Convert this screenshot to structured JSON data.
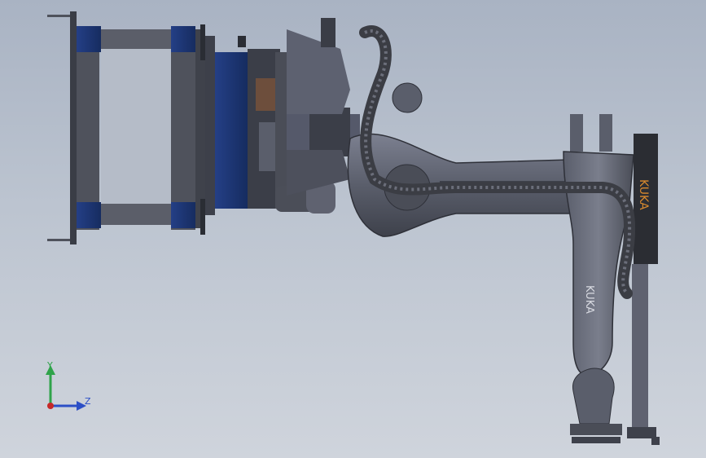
{
  "viewport": {
    "background_top": "#a9b3c3",
    "background_bottom": "#cfd4dc"
  },
  "model": {
    "brand_text_arm": "KUKA",
    "brand_text_cable_sleeve": "KUKA",
    "colors": {
      "robot_body": "#5a5e6b",
      "robot_highlight": "#8a8e9b",
      "frame_steel": "#4f525c",
      "frame_blue": "#1f3a7a",
      "cable_dark": "#3b3d44",
      "brand_orange": "#d98a2e"
    }
  },
  "triad": {
    "y_label": "Y",
    "z_label": "Z",
    "y_color": "#2fa34a",
    "z_color": "#2c4fc6",
    "x_color": "#c62828"
  }
}
